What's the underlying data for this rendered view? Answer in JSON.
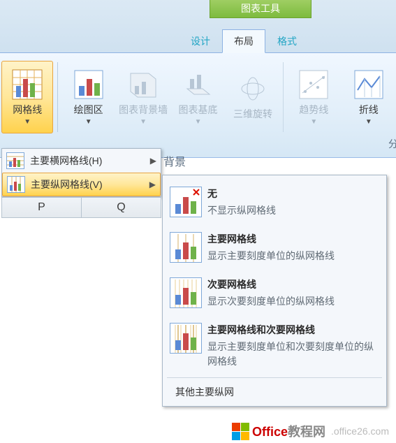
{
  "toolTitle": "图表工具",
  "tabs": {
    "design": "设计",
    "layout": "布局",
    "format": "格式"
  },
  "ribbon": {
    "gridlines": "网格线",
    "plotarea": "绘图区",
    "chartwall": "图表背景墙",
    "chartfloor": "图表基底",
    "rotate3d": "三维旋转",
    "trendline": "趋势线",
    "lines": "折线",
    "groupBackground": "背",
    "groupAnalysis": "分"
  },
  "submenu1": {
    "horiz": "主要横网格线(H)",
    "vert": "主要纵网格线(V)"
  },
  "bgWord": "背景",
  "options": {
    "none": {
      "title": "无",
      "desc": "不显示纵网格线"
    },
    "major": {
      "title": "主要网格线",
      "desc": "显示主要刻度单位的纵网格线"
    },
    "minor": {
      "title": "次要网格线",
      "desc": "显示次要刻度单位的纵网格线"
    },
    "both": {
      "title": "主要网格线和次要网格线",
      "desc": "显示主要刻度单位和次要刻度单位的纵网格线"
    }
  },
  "footer": "其他主要纵网",
  "columns": {
    "p": "P",
    "q": "Q"
  },
  "brand": {
    "red": "Office",
    "gray": "教程网",
    "url": ".office26.com"
  }
}
